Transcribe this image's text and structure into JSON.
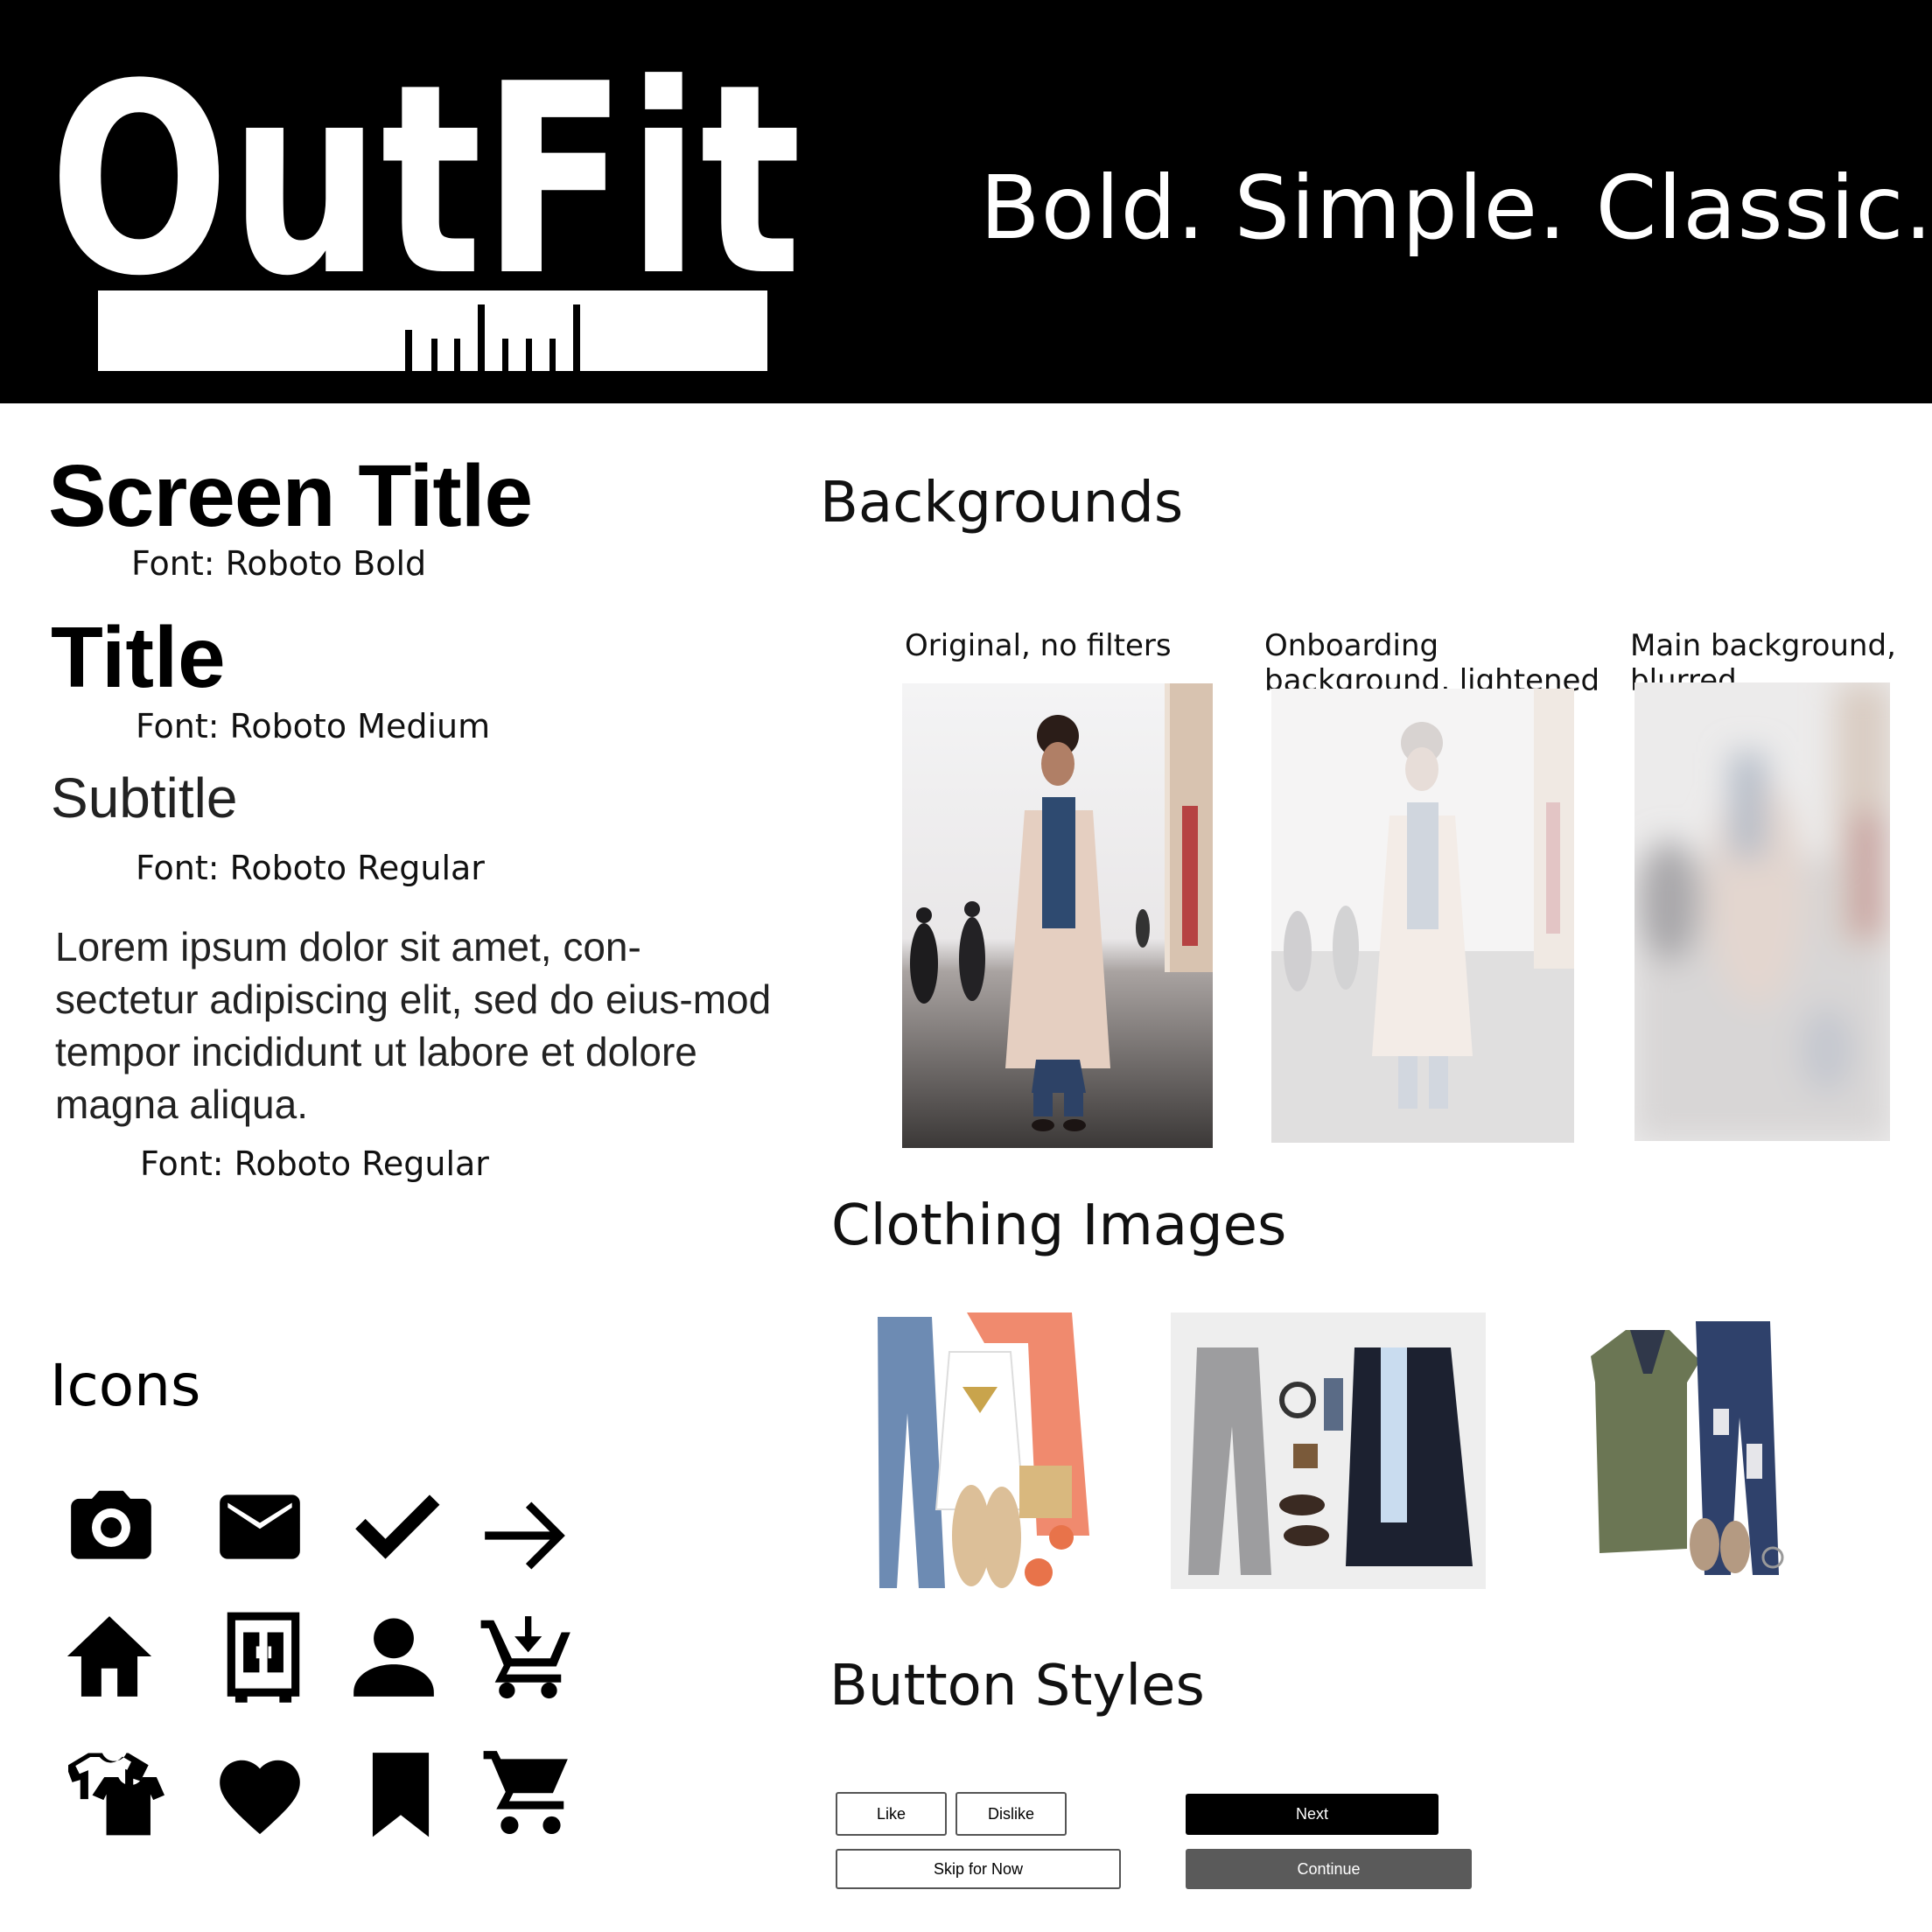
{
  "header": {
    "logo_text": "OutFit",
    "tagline": "Bold. Simple. Classic."
  },
  "typography": {
    "screen_title": {
      "sample": "Screen Title",
      "font": "Font: Roboto Bold"
    },
    "title": {
      "sample": "Title",
      "font": "Font: Roboto Medium"
    },
    "subtitle": {
      "sample": "Subtitle",
      "font": "Font: Roboto Regular"
    },
    "body": {
      "sample": "Lorem ipsum dolor sit amet, con-sectetur adipiscing elit, sed do eius-mod tempor incididunt ut labore et dolore magna aliqua.",
      "font": "Font: Roboto Regular"
    }
  },
  "icons": {
    "heading": "Icons",
    "items": [
      "camera-icon",
      "mail-icon",
      "check-icon",
      "arrow-right-icon",
      "home-icon",
      "wardrobe-icon",
      "person-icon",
      "add-to-cart-icon",
      "shirts-icon",
      "heart-icon",
      "bookmark-icon",
      "cart-icon"
    ]
  },
  "backgrounds": {
    "heading": "Backgrounds",
    "captions": {
      "original": "Original, no filters",
      "onboarding": "Onboarding background, lightened",
      "main": "Main background, blurred"
    }
  },
  "clothing": {
    "heading": "Clothing Images"
  },
  "buttons": {
    "heading": "Button Styles",
    "like": "Like",
    "dislike": "Dislike",
    "skip": "Skip for Now",
    "next": "Next",
    "continue": "Continue"
  },
  "colors": {
    "header_bg": "#000000",
    "primary_button": "#000000",
    "secondary_button": "#5a5a5a",
    "outline_border": "#555555"
  }
}
